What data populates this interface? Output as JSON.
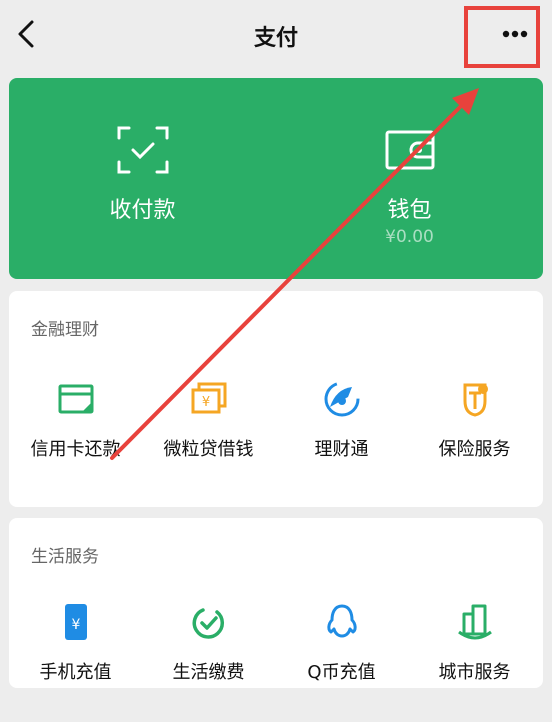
{
  "header": {
    "title": "支付",
    "more_label": "···"
  },
  "pay_card": {
    "items": [
      {
        "label": "收付款",
        "icon": "scan-pay-icon"
      },
      {
        "label": "钱包",
        "balance": "¥0.00",
        "icon": "wallet-icon"
      }
    ]
  },
  "finance": {
    "title": "金融理财",
    "items": [
      {
        "label": "信用卡还款",
        "icon": "credit-card-icon"
      },
      {
        "label": "微粒贷借钱",
        "icon": "loan-icon"
      },
      {
        "label": "理财通",
        "icon": "wealth-icon"
      },
      {
        "label": "保险服务",
        "icon": "insurance-icon"
      }
    ]
  },
  "life": {
    "title": "生活服务",
    "items": [
      {
        "label": "手机充值",
        "icon": "phone-topup-icon"
      },
      {
        "label": "生活缴费",
        "icon": "utility-bill-icon"
      },
      {
        "label": "Q币充值",
        "icon": "qq-coin-icon"
      },
      {
        "label": "城市服务",
        "icon": "city-service-icon"
      }
    ]
  },
  "colors": {
    "brand_green": "#2aae67",
    "annotation_red": "#e8423c",
    "page_bg": "#ededed"
  }
}
